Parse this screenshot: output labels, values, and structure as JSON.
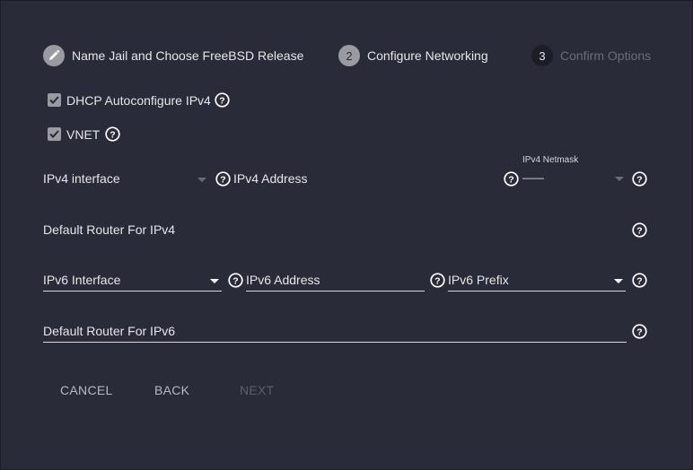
{
  "stepper": {
    "steps": [
      {
        "label": "Name Jail and Choose FreeBSD Release",
        "indicator": "",
        "state": "done",
        "icon": "pencil-icon"
      },
      {
        "label": "Configure Networking",
        "indicator": "2",
        "state": "active"
      },
      {
        "label": "Confirm Options",
        "indicator": "3",
        "state": "inactive"
      }
    ]
  },
  "options": {
    "dhcp_label": "DHCP Autoconfigure IPv4",
    "dhcp_checked": true,
    "vnet_label": "VNET",
    "vnet_checked": true
  },
  "ipv4": {
    "interface_placeholder": "IPv4 interface",
    "address_placeholder": "IPv4 Address",
    "netmask_label": "IPv4 Netmask",
    "netmask_value": "——"
  },
  "default_router_ipv4": "Default Router For IPv4",
  "ipv6": {
    "interface_placeholder": "IPv6 Interface",
    "address_placeholder": "IPv6 Address",
    "prefix_placeholder": "IPv6 Prefix"
  },
  "default_router_ipv6": "Default Router For IPv6",
  "buttons": {
    "cancel": "CANCEL",
    "back": "BACK",
    "next": "NEXT"
  },
  "colors": {
    "background": "#2a2b38",
    "text": "#e6e6ea",
    "muted": "#6b6c78",
    "step_circle": "#9a9aa2"
  }
}
